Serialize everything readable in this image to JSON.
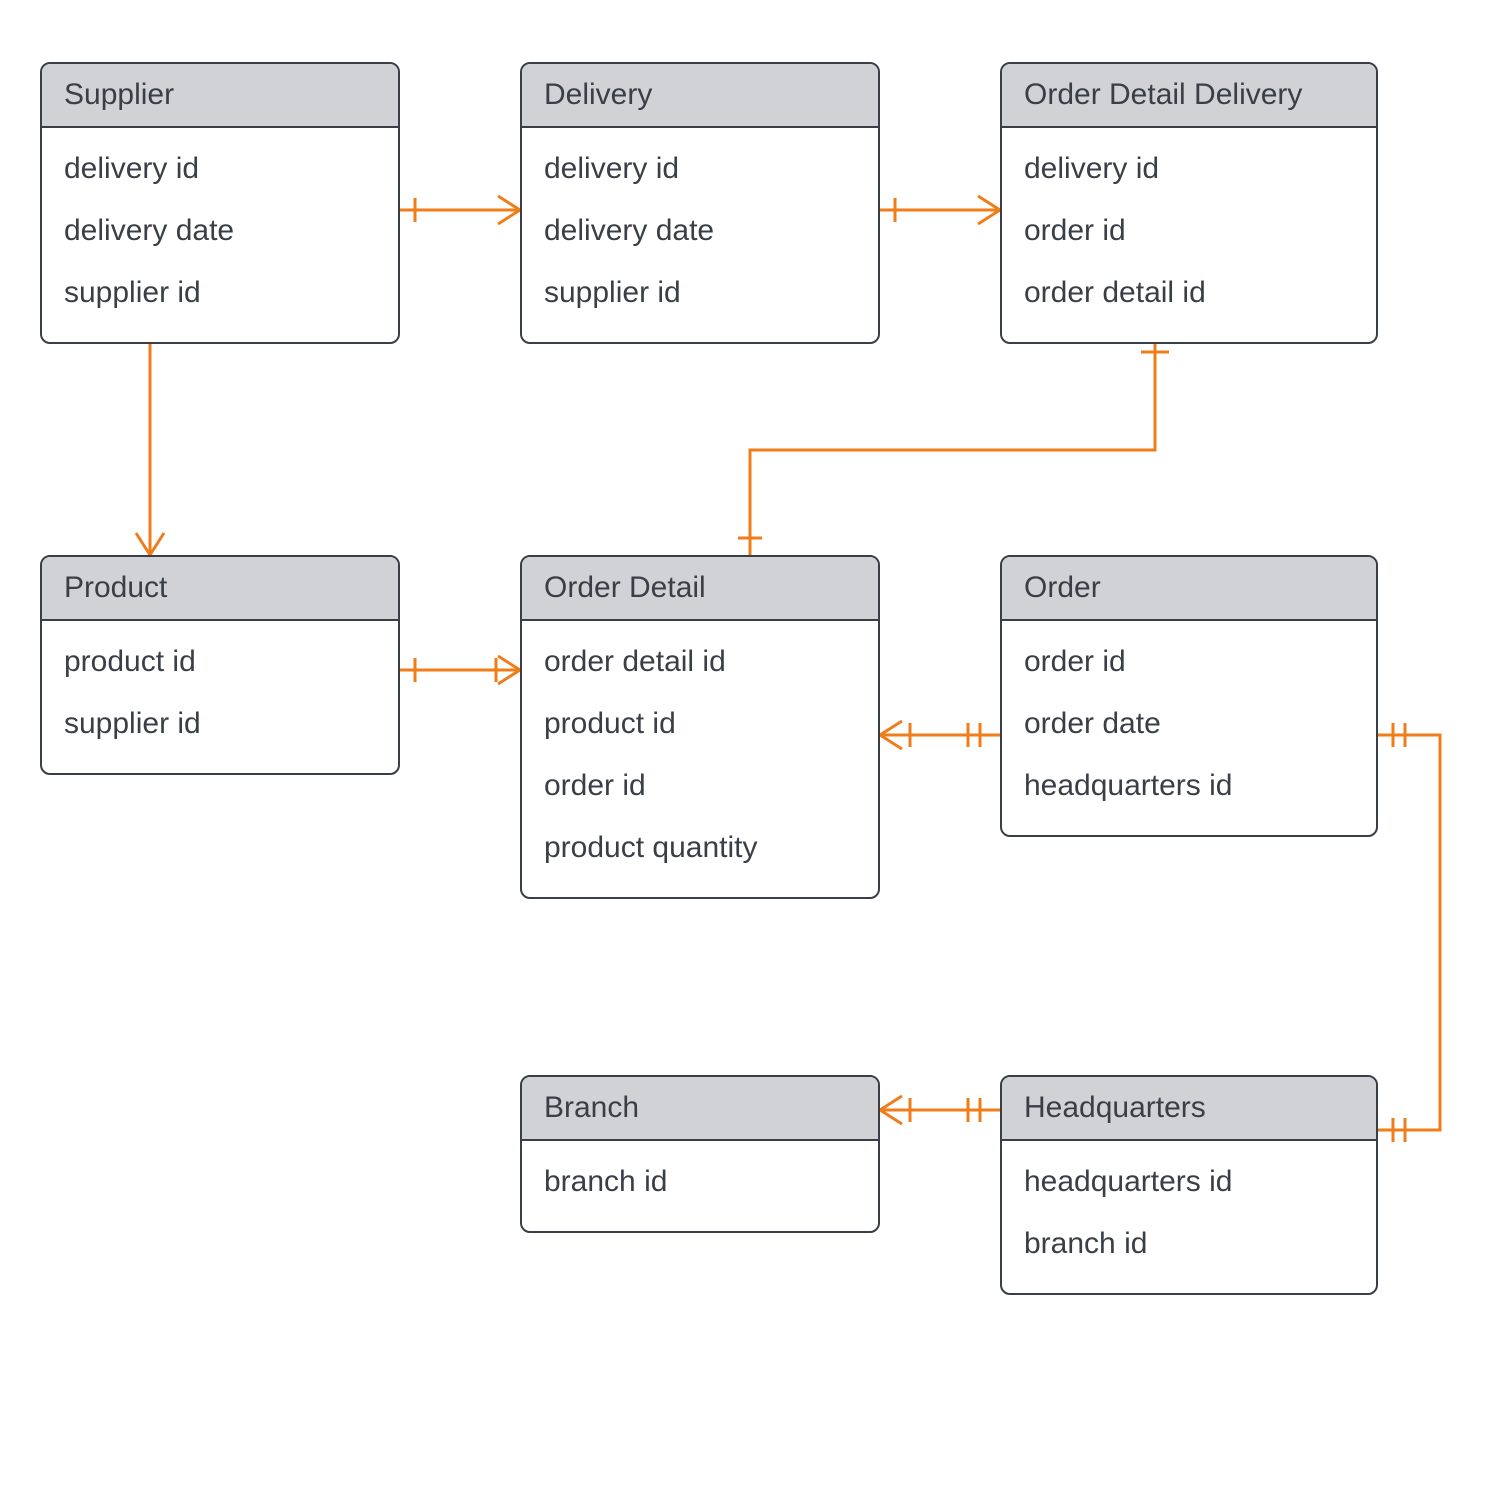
{
  "entities": {
    "supplier": {
      "title": "Supplier",
      "attrs": [
        "delivery id",
        "delivery date",
        "supplier id"
      ]
    },
    "delivery": {
      "title": "Delivery",
      "attrs": [
        "delivery id",
        "delivery date",
        "supplier id"
      ]
    },
    "orderDetailDelivery": {
      "title": "Order Detail Delivery",
      "attrs": [
        "delivery id",
        "order id",
        "order detail id"
      ]
    },
    "product": {
      "title": "Product",
      "attrs": [
        "product id",
        "supplier id"
      ]
    },
    "orderDetail": {
      "title": "Order Detail",
      "attrs": [
        "order detail id",
        "product id",
        "order id",
        "product quantity"
      ]
    },
    "order": {
      "title": "Order",
      "attrs": [
        "order id",
        "order date",
        "headquarters id"
      ]
    },
    "branch": {
      "title": "Branch",
      "attrs": [
        "branch id"
      ]
    },
    "headquarters": {
      "title": "Headquarters",
      "attrs": [
        "headquarters id",
        "branch id"
      ]
    }
  },
  "relationships": [
    {
      "from": "supplier",
      "to": "delivery",
      "fromCard": "one",
      "toCard": "many"
    },
    {
      "from": "delivery",
      "to": "orderDetailDelivery",
      "fromCard": "one",
      "toCard": "many"
    },
    {
      "from": "supplier",
      "to": "product",
      "fromCard": "one",
      "toCard": "many"
    },
    {
      "from": "product",
      "to": "orderDetail",
      "fromCard": "one-mandatory",
      "toCard": "many"
    },
    {
      "from": "orderDetail",
      "to": "orderDetailDelivery",
      "fromCard": "one",
      "toCard": "many-mandatory"
    },
    {
      "from": "orderDetail",
      "to": "order",
      "fromCard": "many-mandatory",
      "toCard": "one-mandatory"
    },
    {
      "from": "branch",
      "to": "headquarters",
      "fromCard": "many-mandatory",
      "toCard": "one-mandatory"
    },
    {
      "from": "order",
      "to": "headquarters",
      "fromCard": "one-mandatory",
      "toCard": "one-mandatory"
    }
  ],
  "colors": {
    "connector": "#ef7d1a",
    "border": "#3a3f47",
    "headerBg": "#d0d2d6"
  }
}
